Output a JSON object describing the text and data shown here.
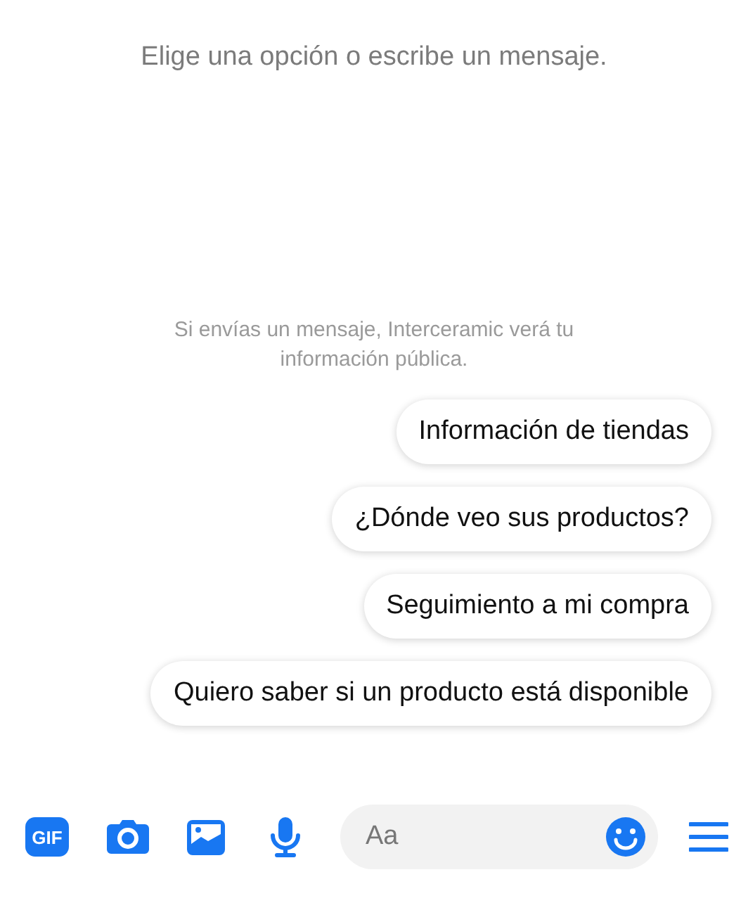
{
  "prompt": "Elige una opción o escribe un mensaje.",
  "notice": [
    "Si envías un mensaje, Interceramic verá tu",
    "información pública."
  ],
  "quick_replies": [
    "Información de tiendas",
    "¿Dónde veo sus productos?",
    "Seguimiento a mi compra",
    "Quiero saber si un producto está disponible"
  ],
  "composer": {
    "gif_label": "GIF",
    "placeholder": "Aa"
  }
}
